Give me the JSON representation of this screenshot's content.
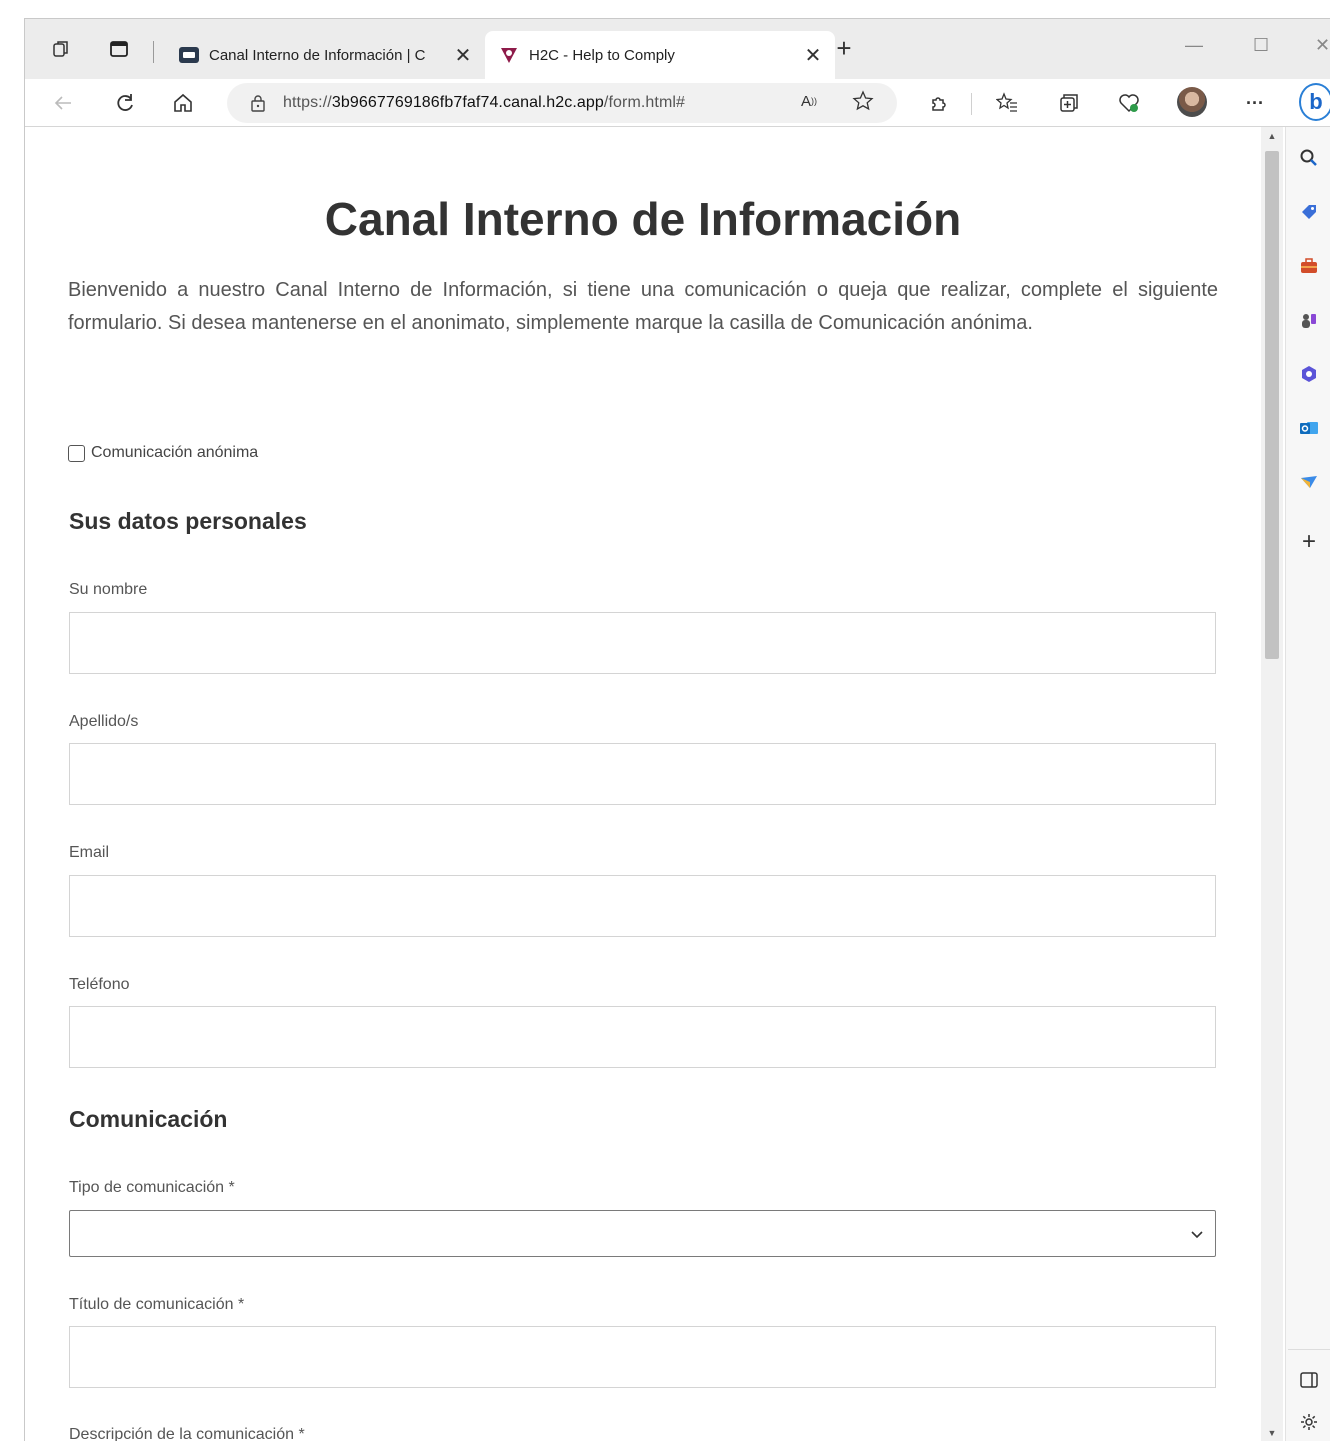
{
  "browser": {
    "tabs": [
      {
        "title": "Canal Interno de Información | C",
        "active": false
      },
      {
        "title": "H2C - Help to Comply",
        "active": true
      }
    ],
    "url_prefix": "https://",
    "url_host": "3b9667769186fb7faf74.canal.h2c.app",
    "url_path": "/form.html#",
    "read_aloud_label": "A",
    "more_label": "···",
    "accent_color": "#1b66c9"
  },
  "page": {
    "title": "Canal Interno de Información",
    "intro": "Bienvenido a nuestro Canal Interno de Información, si tiene una comunicación o queja que realizar, complete el siguiente formulario. Si desea mantenerse en el anonimato, simplemente marque la casilla de Comunicación anónima.",
    "anonymous_checkbox": {
      "label": "Comunicación anónima",
      "checked": false
    },
    "personal_section": {
      "title": "Sus datos personales",
      "first_name": {
        "label": "Su nombre",
        "value": ""
      },
      "last_name": {
        "label": "Apellido/s",
        "value": ""
      },
      "email": {
        "label": "Email",
        "value": ""
      },
      "phone": {
        "label": "Teléfono",
        "value": ""
      }
    },
    "communication_section": {
      "title": "Comunicación",
      "type": {
        "label": "Tipo de comunicación *",
        "value": ""
      },
      "subject": {
        "label": "Título de comunicación *",
        "value": ""
      },
      "description": {
        "label": "Descripción de la comunicación *"
      }
    }
  }
}
